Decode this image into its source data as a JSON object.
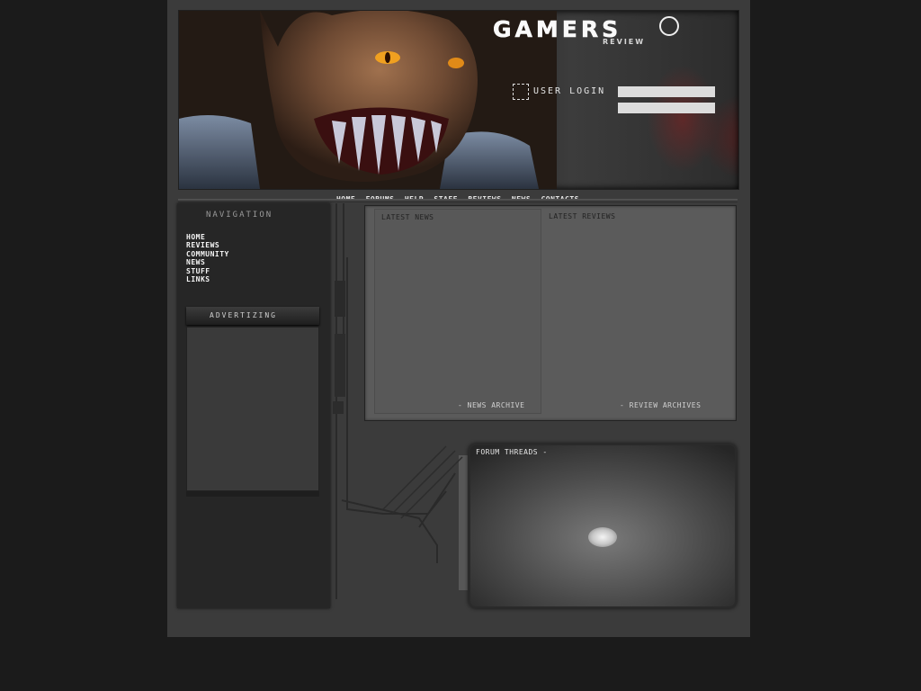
{
  "header": {
    "logo_main": "GAMERS",
    "logo_sub": "REVIEW",
    "login_label": "USER LOGIN",
    "username_value": "",
    "password_value": ""
  },
  "navbar": {
    "items": [
      "HOME",
      "FORUMS",
      "HELP",
      "STAFF",
      "REVIEWS",
      "NEWS",
      "CONTACTS"
    ],
    "separator": "-"
  },
  "sidebar": {
    "title": "NAVIGATION",
    "links": [
      "HOME",
      "REVIEWS",
      "COMMUNITY",
      "NEWS",
      "STUFF",
      "LINKS"
    ],
    "ad_title": "ADVERTIZING"
  },
  "content": {
    "news_title": "LATEST NEWS",
    "reviews_title": "LATEST REVIEWS",
    "news_archive": "- NEWS ARCHIVE",
    "review_archive": "- REVIEW ARCHIVES"
  },
  "forum": {
    "title": "FORUM THREADS -"
  },
  "colors": {
    "page_bg": "#1b1b1b",
    "frame_bg": "#3b3b3b",
    "panel_bg": "#5b5b5b",
    "creature_eye": "#f0a020"
  }
}
